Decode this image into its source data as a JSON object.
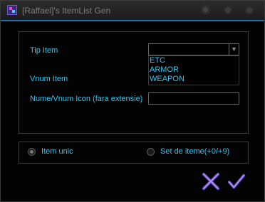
{
  "window": {
    "title": "[Raffael]'s ItemList Gen",
    "icon": "app-icon"
  },
  "form": {
    "tip_item_label": "Tip Item",
    "tip_item_selected": "",
    "tip_item_options": [
      "ETC",
      "ARMOR",
      "WEAPON"
    ],
    "vnum_item_label": "Vnum Item",
    "icon_label": "Nume/Vnum Icon (fara extensie)",
    "icon_value": ""
  },
  "mode": {
    "item_unic_label": "Item unic",
    "set_label": "Set de iteme(+0/+9)",
    "selected": "item_unic"
  },
  "actions": {
    "cancel_icon": "close-x-icon",
    "confirm_icon": "checkmark-icon"
  },
  "colors": {
    "accent": "#1f6fa8",
    "label": "#37c4f0",
    "action": "#7b54d8"
  }
}
